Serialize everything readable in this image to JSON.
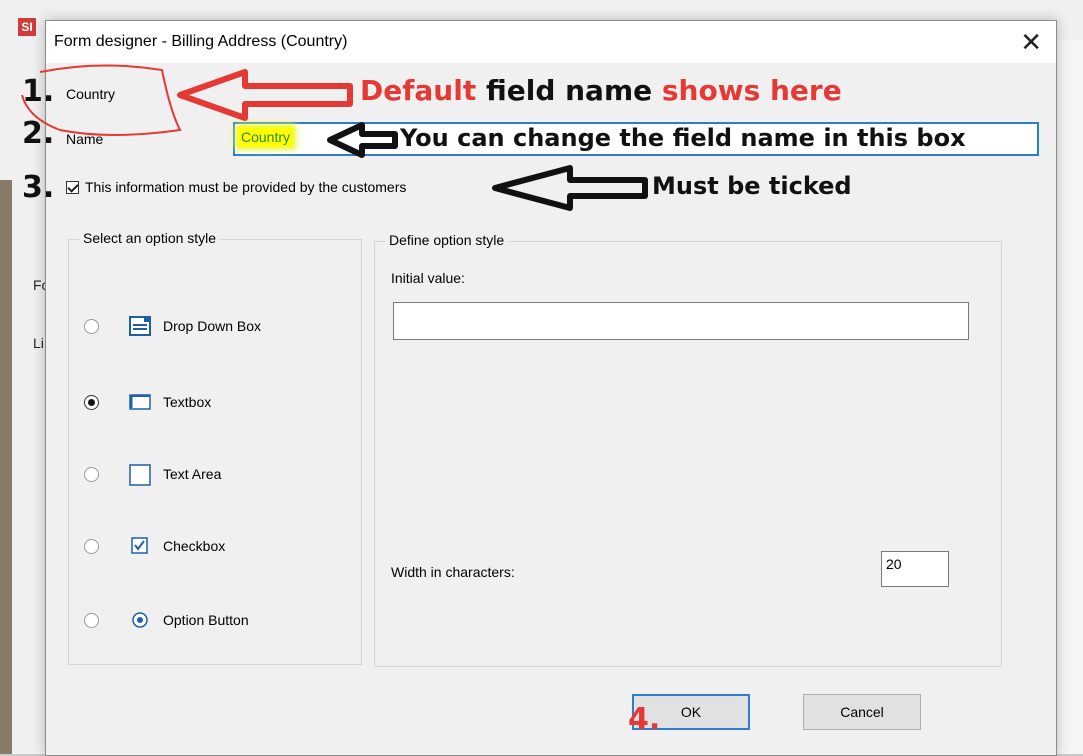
{
  "window": {
    "title": "Form designer - Billing Address (Country)",
    "close_glyph": "✕"
  },
  "background": {
    "app_logo": "SI",
    "frag_fo": "Fo",
    "frag_li": "Li"
  },
  "form": {
    "field_label": "Country",
    "name_label": "Name",
    "name_value": "Country",
    "required_label": "This information must be provided by the customers",
    "required_checked": true
  },
  "option_style_group": {
    "title": "Select an option style",
    "options": [
      {
        "label": "Drop Down Box",
        "icon": "dropdown-icon",
        "selected": false
      },
      {
        "label": "Textbox",
        "icon": "textbox-icon",
        "selected": true
      },
      {
        "label": "Text Area",
        "icon": "textarea-icon",
        "selected": false
      },
      {
        "label": "Checkbox",
        "icon": "checkbox-icon",
        "selected": false
      },
      {
        "label": "Option Button",
        "icon": "option-button-icon",
        "selected": false
      }
    ]
  },
  "define_group": {
    "title": "Define option style",
    "initial_value_label": "Initial value:",
    "initial_value": "",
    "width_label": "Width in characters:",
    "width_value": "20"
  },
  "buttons": {
    "ok": "OK",
    "cancel": "Cancel"
  },
  "annotations": {
    "n1": "1.",
    "n2": "2.",
    "n3": "3.",
    "n4": "4.",
    "a1_red1": "Default",
    "a1_black": "field name",
    "a1_red2": "shows here",
    "a2": "You can change the field name in this box",
    "a3": "Must be ticked",
    "colors": {
      "red": "#e53935",
      "black": "#111111",
      "accent_blue": "#2b7cd3",
      "highlight": "#ffff00"
    }
  }
}
